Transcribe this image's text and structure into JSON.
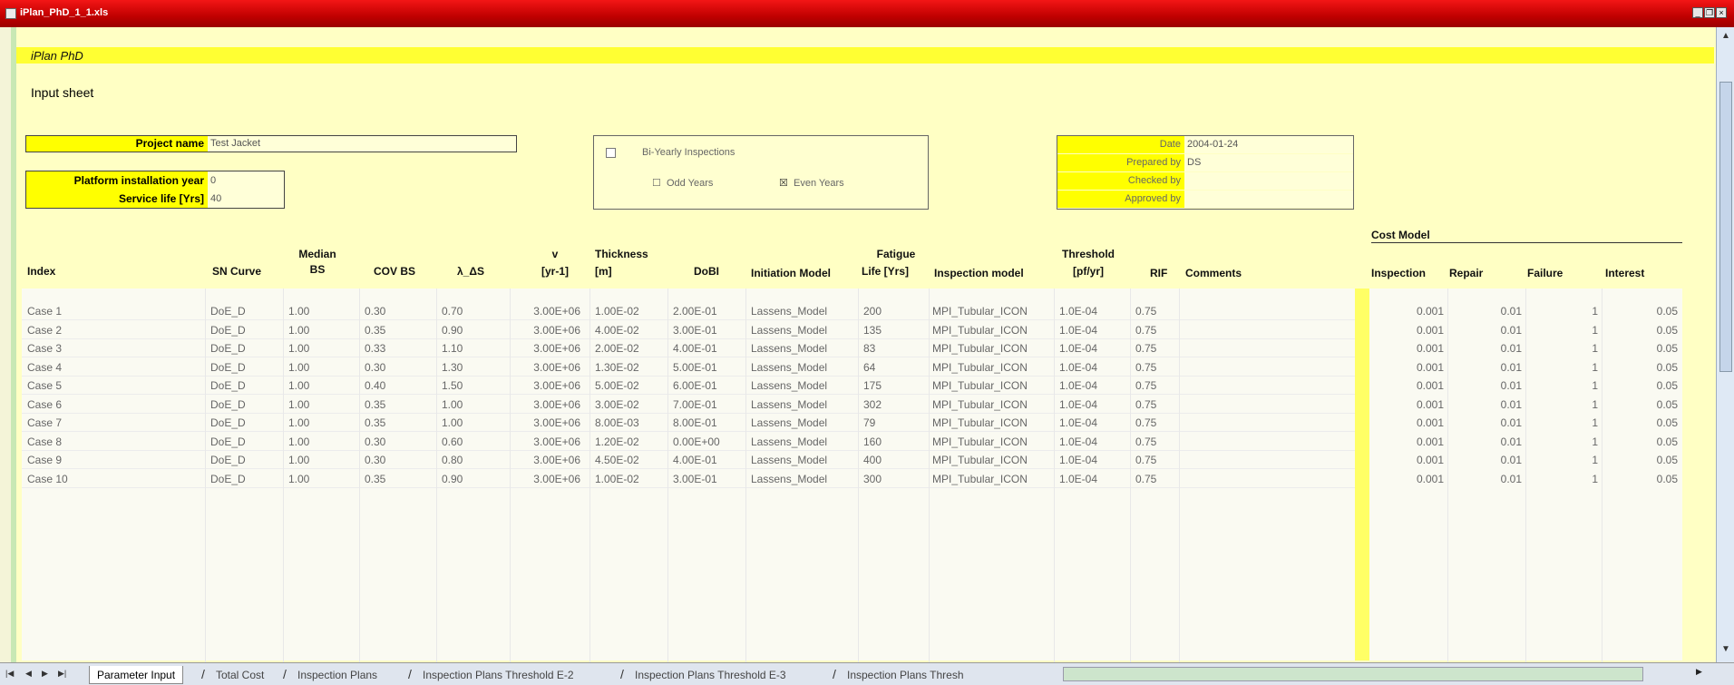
{
  "window": {
    "title": "iPlan_PhD_1_1.xls"
  },
  "brand": "iPlan PhD",
  "sheet_title": "Input sheet",
  "form": {
    "project_name_label": "Project name",
    "project_name_value": "Test Jacket",
    "platform_year_label": "Platform installation year",
    "platform_year_value": "0",
    "service_life_label": "Service life [Yrs]",
    "service_life_value": "40"
  },
  "options": {
    "bi_yearly_label": "Bi-Yearly Inspections",
    "bi_yearly_checked": "☐",
    "odd_years_label": "Odd Years",
    "odd_marker": "☐",
    "even_years_label": "Even Years",
    "even_marker": "☒"
  },
  "meta": {
    "date_label": "Date",
    "date_value": "2004-01-24",
    "prepared_label": "Prepared by",
    "prepared_value": "DS",
    "checked_label": "Checked by",
    "checked_value": "",
    "approved_label": "Approved by",
    "approved_value": ""
  },
  "cost_model_title": "Cost Model",
  "headers": {
    "index": "Index",
    "sn_curve": "SN Curve",
    "median_bs_1": "Median",
    "median_bs_2": "BS",
    "cov_bs": "COV BS",
    "lambda_ds": "λ_ΔS",
    "v_1": "v",
    "v_2": "[yr-1]",
    "thickness_1": "Thickness",
    "thickness_2": "[m]",
    "dobi": "DoBI",
    "initiation_model": "Initiation Model",
    "fatigue_1": "Fatigue",
    "fatigue_2": "Life [Yrs]",
    "inspection_model": "Inspection model",
    "threshold_1": "Threshold",
    "threshold_2": "[pf/yr]",
    "rif": "RIF",
    "comments": "Comments",
    "inspection": "Inspection",
    "repair": "Repair",
    "failure": "Failure",
    "interest": "Interest"
  },
  "rows": [
    {
      "index": "Case 1",
      "sn": "DoE_D",
      "median": "1.00",
      "cov": "0.30",
      "lambda": "0.70",
      "v": "3.00E+06",
      "thick": "1.00E-02",
      "dobi": "2.00E-01",
      "init": "Lassens_Model",
      "fatigue": "200",
      "insp_model": "MPI_Tubular_ICON",
      "threshold": "1.0E-04",
      "rif": "0.75",
      "inspection": "0.001",
      "repair": "0.01",
      "failure": "1",
      "interest": "0.05"
    },
    {
      "index": "Case 2",
      "sn": "DoE_D",
      "median": "1.00",
      "cov": "0.35",
      "lambda": "0.90",
      "v": "3.00E+06",
      "thick": "4.00E-02",
      "dobi": "3.00E-01",
      "init": "Lassens_Model",
      "fatigue": "135",
      "insp_model": "MPI_Tubular_ICON",
      "threshold": "1.0E-04",
      "rif": "0.75",
      "inspection": "0.001",
      "repair": "0.01",
      "failure": "1",
      "interest": "0.05"
    },
    {
      "index": "Case 3",
      "sn": "DoE_D",
      "median": "1.00",
      "cov": "0.33",
      "lambda": "1.10",
      "v": "3.00E+06",
      "thick": "2.00E-02",
      "dobi": "4.00E-01",
      "init": "Lassens_Model",
      "fatigue": "83",
      "insp_model": "MPI_Tubular_ICON",
      "threshold": "1.0E-04",
      "rif": "0.75",
      "inspection": "0.001",
      "repair": "0.01",
      "failure": "1",
      "interest": "0.05"
    },
    {
      "index": "Case 4",
      "sn": "DoE_D",
      "median": "1.00",
      "cov": "0.30",
      "lambda": "1.30",
      "v": "3.00E+06",
      "thick": "1.30E-02",
      "dobi": "5.00E-01",
      "init": "Lassens_Model",
      "fatigue": "64",
      "insp_model": "MPI_Tubular_ICON",
      "threshold": "1.0E-04",
      "rif": "0.75",
      "inspection": "0.001",
      "repair": "0.01",
      "failure": "1",
      "interest": "0.05"
    },
    {
      "index": "Case 5",
      "sn": "DoE_D",
      "median": "1.00",
      "cov": "0.40",
      "lambda": "1.50",
      "v": "3.00E+06",
      "thick": "5.00E-02",
      "dobi": "6.00E-01",
      "init": "Lassens_Model",
      "fatigue": "175",
      "insp_model": "MPI_Tubular_ICON",
      "threshold": "1.0E-04",
      "rif": "0.75",
      "inspection": "0.001",
      "repair": "0.01",
      "failure": "1",
      "interest": "0.05"
    },
    {
      "index": "Case 6",
      "sn": "DoE_D",
      "median": "1.00",
      "cov": "0.35",
      "lambda": "1.00",
      "v": "3.00E+06",
      "thick": "3.00E-02",
      "dobi": "7.00E-01",
      "init": "Lassens_Model",
      "fatigue": "302",
      "insp_model": "MPI_Tubular_ICON",
      "threshold": "1.0E-04",
      "rif": "0.75",
      "inspection": "0.001",
      "repair": "0.01",
      "failure": "1",
      "interest": "0.05"
    },
    {
      "index": "Case 7",
      "sn": "DoE_D",
      "median": "1.00",
      "cov": "0.35",
      "lambda": "1.00",
      "v": "3.00E+06",
      "thick": "8.00E-03",
      "dobi": "8.00E-01",
      "init": "Lassens_Model",
      "fatigue": "79",
      "insp_model": "MPI_Tubular_ICON",
      "threshold": "1.0E-04",
      "rif": "0.75",
      "inspection": "0.001",
      "repair": "0.01",
      "failure": "1",
      "interest": "0.05"
    },
    {
      "index": "Case 8",
      "sn": "DoE_D",
      "median": "1.00",
      "cov": "0.30",
      "lambda": "0.60",
      "v": "3.00E+06",
      "thick": "1.20E-02",
      "dobi": "0.00E+00",
      "init": "Lassens_Model",
      "fatigue": "160",
      "insp_model": "MPI_Tubular_ICON",
      "threshold": "1.0E-04",
      "rif": "0.75",
      "inspection": "0.001",
      "repair": "0.01",
      "failure": "1",
      "interest": "0.05"
    },
    {
      "index": "Case 9",
      "sn": "DoE_D",
      "median": "1.00",
      "cov": "0.30",
      "lambda": "0.80",
      "v": "3.00E+06",
      "thick": "4.50E-02",
      "dobi": "4.00E-01",
      "init": "Lassens_Model",
      "fatigue": "400",
      "insp_model": "MPI_Tubular_ICON",
      "threshold": "1.0E-04",
      "rif": "0.75",
      "inspection": "0.001",
      "repair": "0.01",
      "failure": "1",
      "interest": "0.05"
    },
    {
      "index": "Case 10",
      "sn": "DoE_D",
      "median": "1.00",
      "cov": "0.35",
      "lambda": "0.90",
      "v": "3.00E+06",
      "thick": "1.00E-02",
      "dobi": "3.00E-01",
      "init": "Lassens_Model",
      "fatigue": "300",
      "insp_model": "MPI_Tubular_ICON",
      "threshold": "1.0E-04",
      "rif": "0.75",
      "inspection": "0.001",
      "repair": "0.01",
      "failure": "1",
      "interest": "0.05"
    }
  ],
  "tabs": [
    {
      "label": "Parameter Input",
      "active": true
    },
    {
      "label": "Total Cost",
      "active": false
    },
    {
      "label": "Inspection Plans",
      "active": false
    },
    {
      "label": "Inspection Plans Threshold E-2",
      "active": false
    },
    {
      "label": "Inspection Plans Threshold E-3",
      "active": false
    },
    {
      "label": "Inspection Plans Thresh",
      "active": false
    }
  ]
}
